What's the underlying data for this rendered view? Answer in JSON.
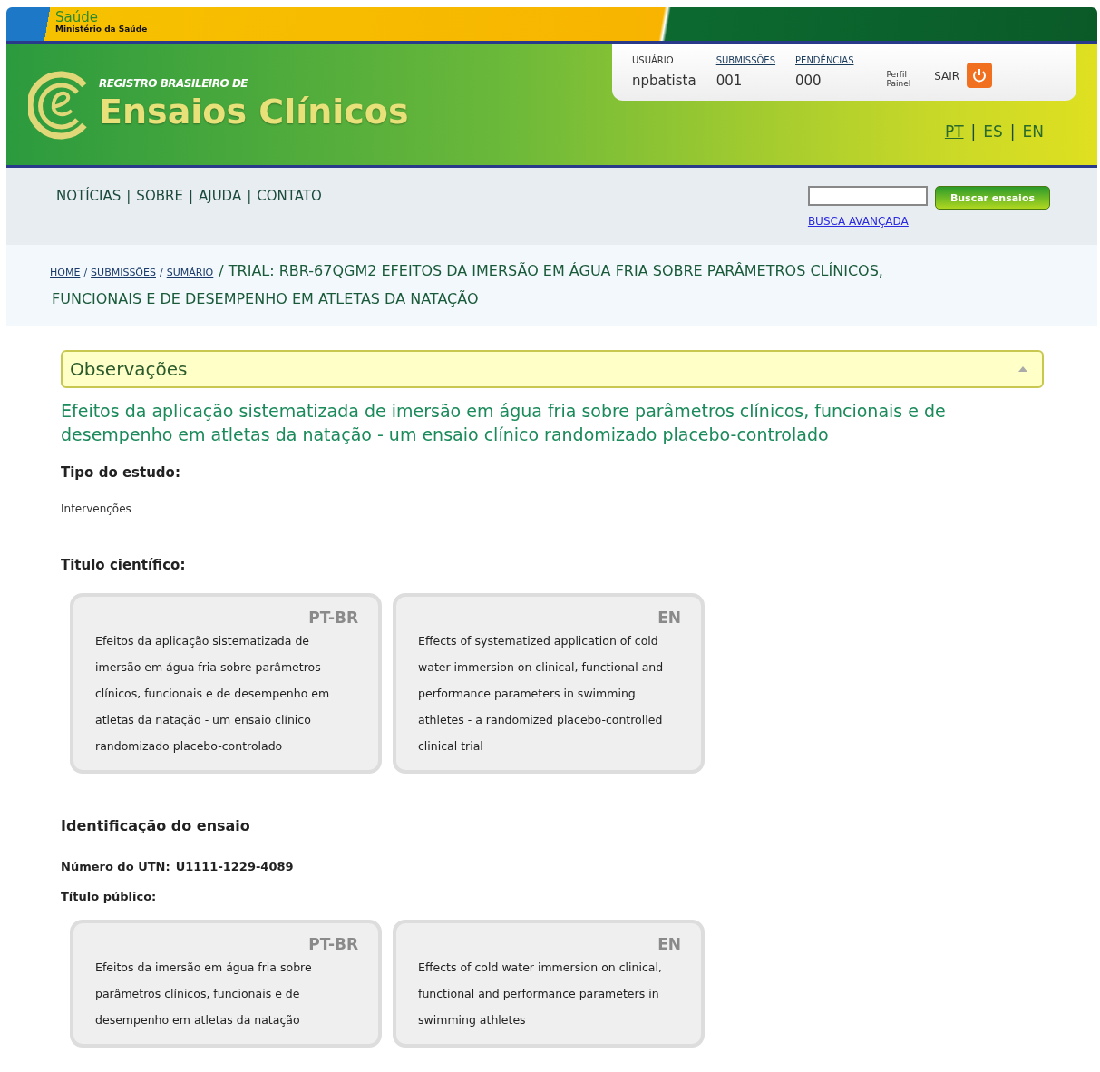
{
  "gov_banner": {
    "title": "Saúde",
    "subtitle": "Ministério da Saúde"
  },
  "header": {
    "tagline": "REGISTRO BRASILEIRO DE",
    "title": "Ensaios Clínicos"
  },
  "user_panel": {
    "columns": [
      {
        "label": "USUÁRIO",
        "value": "npbatista",
        "link": false
      },
      {
        "label": "SUBMISSÕES",
        "value": "001",
        "link": true
      },
      {
        "label": "PENDÊNCIAS",
        "value": "000",
        "link": true
      }
    ],
    "links": [
      "Perfil",
      "Painel"
    ],
    "logout": "SAIR"
  },
  "languages": [
    {
      "label": "PT",
      "selected": true
    },
    {
      "label": "ES",
      "selected": false
    },
    {
      "label": "EN",
      "selected": false
    }
  ],
  "language_separator": "|",
  "nav": {
    "items": [
      "NOTÍCIAS",
      "SOBRE",
      "AJUDA",
      "CONTATO"
    ],
    "separator": "|"
  },
  "search": {
    "button": "Buscar ensaios",
    "advanced": "BUSCA AVANÇADA"
  },
  "breadcrumb": {
    "links": [
      "HOME",
      "SUBMISSÕES",
      "SUMÁRIO"
    ],
    "separator": "/",
    "title_lines": [
      "/ TRIAL: RBR-67QGM2 EFEITOS DA IMERSÃO EM ÁGUA FRIA SOBRE PARÂMETROS CLÍNICOS,",
      "FUNCIONAIS E DE DESEMPENHO EM ATLETAS DA NATAÇÃO"
    ]
  },
  "panel": {
    "title": "Observações",
    "expanded": true
  },
  "headline": "Efeitos da aplicação sistematizada de imersão em água fria sobre parâmetros clínicos, funcionais e de desempenho em atletas da natação - um ensaio clínico randomizado placebo-controlado",
  "study_type": {
    "label": "Tipo do estudo:",
    "value": "Intervenções"
  },
  "scientific_title": {
    "label": "Titulo científico:",
    "cards": [
      {
        "lang": "PT-BR",
        "text": "Efeitos da aplicação sistematizada de imersão em água fria sobre parâmetros clínicos, funcionais e de desempenho em atletas da natação - um ensaio clínico randomizado placebo-controlado"
      },
      {
        "lang": "EN",
        "text": "Effects of systematized application of cold water immersion on clinical, functional and performance parameters in swimming athletes - a randomized placebo-controlled clinical trial"
      }
    ]
  },
  "identification": {
    "heading": "Identificação do ensaio",
    "utn_label": "Número do UTN:",
    "utn_value": "U1111-1229-4089",
    "public_title_label": "Título público:",
    "cards": [
      {
        "lang": "PT-BR",
        "text": "Efeitos da imersão em água fria sobre parâmetros clínicos, funcionais e de desempenho em atletas da natação"
      },
      {
        "lang": "EN",
        "text": "Effects of cold water immersion on clinical, functional and performance parameters in swimming athletes"
      }
    ]
  }
}
